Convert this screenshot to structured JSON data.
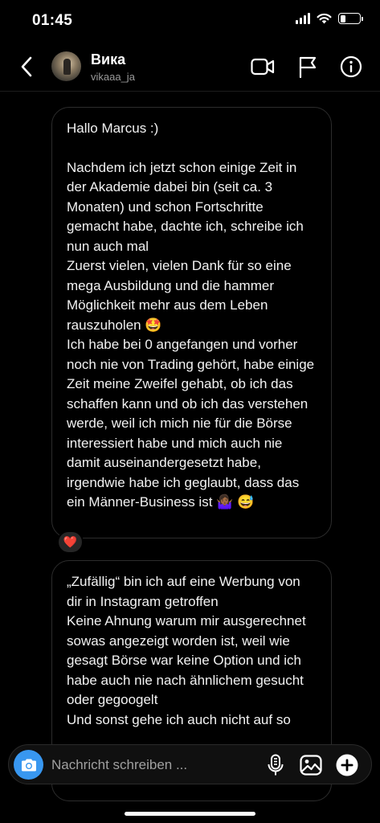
{
  "status_bar": {
    "time": "01:45",
    "battery_level": 0.3
  },
  "header": {
    "back_icon": "chevron-left-icon",
    "contact_name": "Вика",
    "contact_handle": "vikaaa_ja",
    "actions": [
      "video-call-icon",
      "flag-icon",
      "info-icon"
    ]
  },
  "messages": [
    {
      "paragraphs": [
        "Hallo Marcus :)",
        "Nachdem ich jetzt schon einige Zeit in der Akademie dabei bin (seit ca. 3 Monaten) und schon Fortschritte gemacht habe, dachte ich, schreibe ich nun auch mal",
        "Zuerst vielen, vielen Dank für so eine mega Ausbildung und die hammer Möglichkeit mehr aus dem Leben rauszuholen 🤩",
        "Ich habe bei 0 angefangen und vorher noch nie von Trading gehört, habe einige Zeit meine Zweifel gehabt, ob ich das schaffen kann und ob ich das verstehen werde, weil ich mich nie für die Börse interessiert habe und mich auch nie damit auseinandergesetzt habe, irgendwie habe ich geglaubt, dass das ein Männer-Business ist 🤷🏾‍♀️ 😅"
      ],
      "reaction": "❤️"
    },
    {
      "paragraphs": [
        "„Zufällig“ bin ich auf eine Werbung von dir in Instagram getroffen",
        "Keine Ahnung warum mir ausgerechnet sowas angezeigt worden ist, weil wie gesagt Börse war keine Option und ich habe auch nie nach ähnlichem gesucht oder gegoogelt",
        "Und sonst gehe ich auch nicht auf so"
      ]
    }
  ],
  "composer": {
    "placeholder": "Nachricht schreiben ...",
    "camera_icon": "camera-icon",
    "mic_icon": "microphone-icon",
    "gallery_icon": "gallery-icon",
    "add_icon": "plus-circle-icon",
    "accent_color": "#3897f0"
  }
}
